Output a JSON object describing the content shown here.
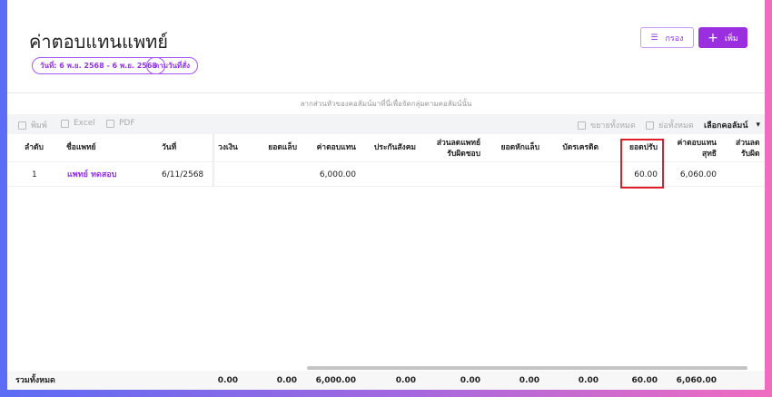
{
  "page": {
    "title": "ค่าตอบแทนแพทย์",
    "chips": [
      "วันที่: 6 พ.ย. 2568 - 6 พ.ย. 2568",
      "ตามวันที่สั่ง"
    ],
    "filter_label": "กรอง",
    "add_label": "เพิ่ม",
    "accent": "#9b2fe0"
  },
  "grid": {
    "drag_hint": "ลากส่วนหัวของคอลัมน์มาที่นี่เพื่อจัดกลุ่มตามคอลัมน์นั้น",
    "print": "พิมพ์",
    "excel": "Excel",
    "pdf": "PDF",
    "expand_all": "ขยายทั้งหมด",
    "collapse_all": "ย่อทั้งหมด",
    "choose_columns": "เลือกคอลัมน์"
  },
  "columns": {
    "no": "ลำดับ",
    "doctor": "ชื่อแพทย์",
    "date": "วันที่",
    "limit": "วงเงิน",
    "lab": "ยอดแล็บ",
    "fee": "ค่าตอบแทน",
    "sso": "ประกันสังคม",
    "disc1": "ส่วนลดแพทย์",
    "disc2": "รับผิดชอบ",
    "labded": "ยอดหักแล็บ",
    "credit": "บัตรเครดิต",
    "adjust": "ยอดปรับ",
    "net1": "ค่าตอบแทน",
    "net2": "สุทธิ",
    "more1": "ส่วนลด",
    "more2": "รับผิด"
  },
  "rows": [
    {
      "no": "1",
      "doctor": "แพทย์ ทดสอบ",
      "date": "6/11/2568",
      "fee": "6,000.00",
      "adjust": "60.00",
      "net": "6,060.00"
    }
  ],
  "totals": {
    "label": "รวมทั้งหมด",
    "limit": "0.00",
    "lab": "0.00",
    "fee": "6,000.00",
    "sso": "0.00",
    "disc": "0.00",
    "labded": "0.00",
    "credit": "0.00",
    "adjust": "60.00",
    "net": "6,060.00"
  }
}
